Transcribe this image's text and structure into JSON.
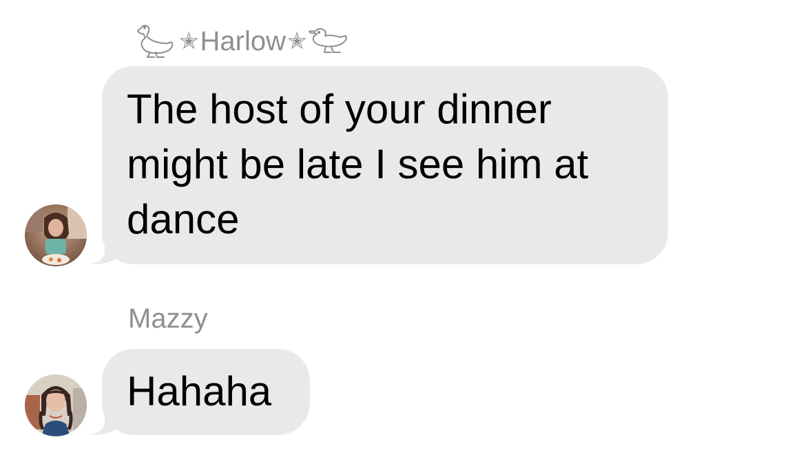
{
  "messages": [
    {
      "sender": "Harlow",
      "sender_star_left": "✭",
      "sender_star_right": "✭",
      "text": "The host of your dinner might be late I see him at dance",
      "avatar_icon": "person-photo-avatar"
    },
    {
      "sender": "Mazzy",
      "text": "Hahaha",
      "avatar_icon": "person-photo-avatar"
    }
  ],
  "colors": {
    "bubble_incoming": "#e9e9eb",
    "sender_name": "#8e8e93",
    "background": "#ffffff"
  }
}
